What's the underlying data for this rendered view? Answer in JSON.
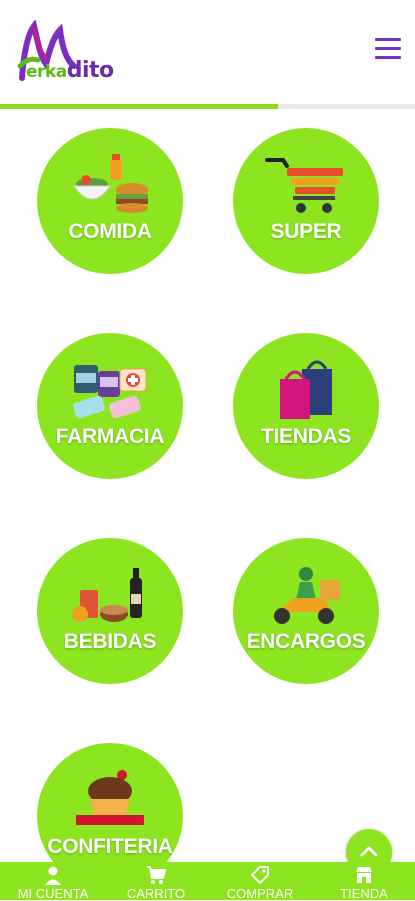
{
  "header": {
    "logo_letter": "M",
    "logo_text_green": "erka",
    "logo_text_purple": "dito",
    "menu_icon": "hamburger-icon"
  },
  "loading_progress": 0.67,
  "categories": [
    {
      "label": "COMIDA",
      "icon": "food-icon"
    },
    {
      "label": "SUPER",
      "icon": "cart-icon"
    },
    {
      "label": "FARMACIA",
      "icon": "pharmacy-icon"
    },
    {
      "label": "TIENDAS",
      "icon": "shopping-bags-icon"
    },
    {
      "label": "BEBIDAS",
      "icon": "drinks-icon"
    },
    {
      "label": "ENCARGOS",
      "icon": "delivery-scooter-icon"
    },
    {
      "label": "CONFITERIA",
      "icon": "cupcake-icon"
    }
  ],
  "scroll_top_icon": "chevron-up-icon",
  "bottom_nav": [
    {
      "label": "MI CUENTA",
      "icon": "user-icon"
    },
    {
      "label": "CARRITO",
      "icon": "cart-icon"
    },
    {
      "label": "COMPRAR",
      "icon": "tag-icon"
    },
    {
      "label": "TIENDA",
      "icon": "store-icon"
    }
  ],
  "colors": {
    "accent": "#8ce51e",
    "brand_purple": "#7a2fc0",
    "brand_green": "#5dbb18"
  }
}
